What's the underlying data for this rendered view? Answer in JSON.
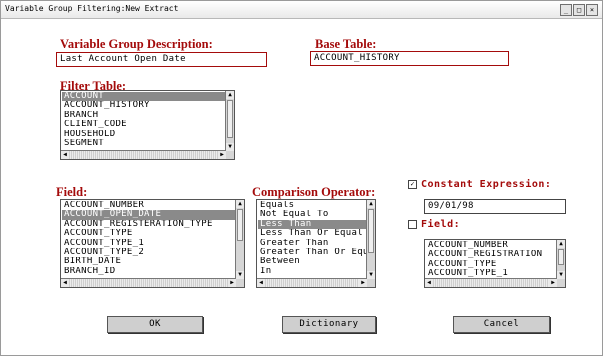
{
  "window": {
    "title": "Variable Group Filtering:New Extract",
    "controls": [
      "_",
      "□",
      "×"
    ]
  },
  "description": {
    "label": "Variable Group Description:",
    "value": "Last Account Open Date"
  },
  "base_table": {
    "label": "Base Table:",
    "value": "ACCOUNT_HISTORY"
  },
  "filter_table": {
    "label": "Filter Table:",
    "items": [
      "ACCOUNT",
      "ACCOUNT_HISTORY",
      "BRANCH",
      "CLIENT_CODE",
      "HOUSEHOLD",
      "SEGMENT"
    ],
    "selected_index": 0
  },
  "field": {
    "label": "Field:",
    "items": [
      "ACCOUNT_NUMBER",
      "ACCOUNT_OPEN_DATE",
      "ACCOUNT_REGISTERATION_TYPE",
      "ACCOUNT_TYPE",
      "ACCOUNT_TYPE_1",
      "ACCOUNT_TYPE_2",
      "BIRTH_DATE",
      "BRANCH_ID"
    ],
    "selected_index": 1
  },
  "comparison": {
    "label": "Comparison Operator:",
    "items": [
      "Equals",
      "Not Equal To",
      "Less Than",
      "Less Than Or Equal",
      "Greater Than",
      "Greater Than Or Equal",
      "Between",
      "In"
    ],
    "selected_index": 2
  },
  "constant_expression": {
    "label": "Constant Expression:",
    "checked": true,
    "check_mark": "✓",
    "value": "09/01/98"
  },
  "field_option": {
    "label": "Field:",
    "checked": false,
    "items": [
      "ACCOUNT_NUMBER",
      "ACCOUNT_REGISTRATION",
      "ACCOUNT_TYPE",
      "ACCOUNT_TYPE_1"
    ]
  },
  "buttons": {
    "ok": "OK",
    "dictionary": "Dictionary",
    "cancel": "Cancel"
  },
  "colors": {
    "label": "#a40b0b",
    "selection": "#8a8a8a",
    "button": "#cfcfcf"
  }
}
